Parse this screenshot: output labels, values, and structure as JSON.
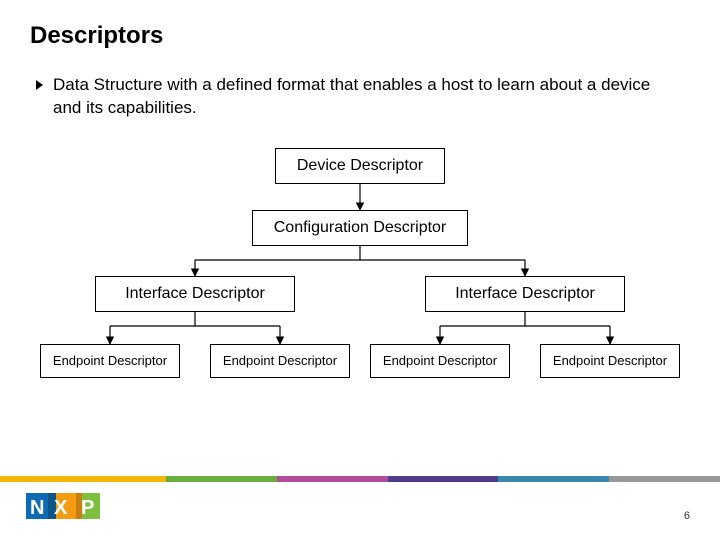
{
  "title": "Descriptors",
  "bullet": "Data Structure with a defined format that enables a host to learn about a device and its capabilities.",
  "nodes": {
    "device": "Device Descriptor",
    "config": "Configuration Descriptor",
    "iface_left": "Interface Descriptor",
    "iface_right": "Interface Descriptor",
    "ep1": "Endpoint Descriptor",
    "ep2": "Endpoint Descriptor",
    "ep3": "Endpoint Descriptor",
    "ep4": "Endpoint Descriptor"
  },
  "page_number": "6",
  "logo": {
    "text": "NXP",
    "brand_colors": {
      "n_blue": "#0e6bb3",
      "x_orange": "#f39c12",
      "p_green": "#7fbf3f"
    }
  }
}
